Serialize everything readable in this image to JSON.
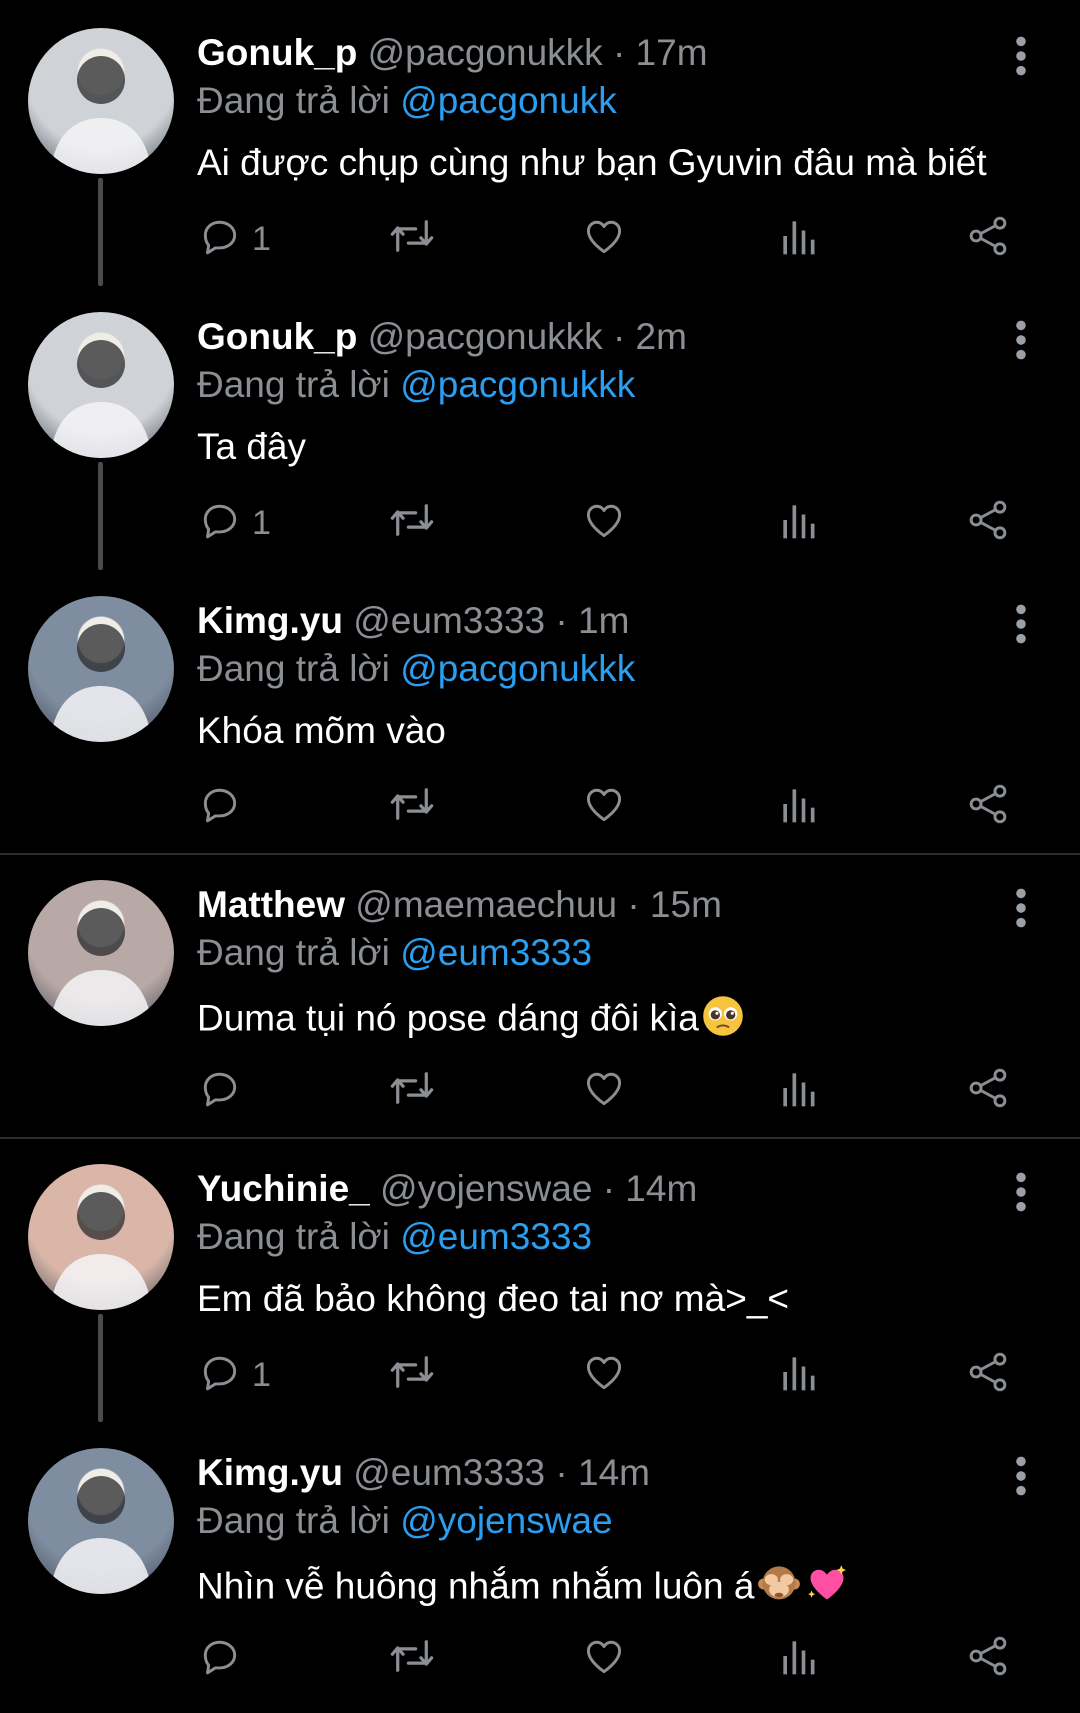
{
  "labels": {
    "replying_to": "Đang trả lời"
  },
  "tweets": [
    {
      "name": "Gonuk_p",
      "handle": "@pacgonukkk",
      "sep": "·",
      "time": "17m",
      "reply_to": "@pacgonukk",
      "text": "Ai được chụp cùng như bạn Gyuvin đâu mà biết",
      "reply_count": "1",
      "emoji": [],
      "avatar_color": "#cfd2d6"
    },
    {
      "name": "Gonuk_p",
      "handle": "@pacgonukkk",
      "sep": "·",
      "time": "2m",
      "reply_to": "@pacgonukkk",
      "text": "Ta đây",
      "reply_count": "1",
      "emoji": [],
      "avatar_color": "#cfd2d6"
    },
    {
      "name": "Kimg.yu",
      "handle": "@eum3333",
      "sep": "·",
      "time": "1m",
      "reply_to": "@pacgonukkk",
      "text": "Khóa mõm vào",
      "reply_count": "",
      "emoji": [],
      "avatar_color": "#7f8da0"
    },
    {
      "name": "Matthew",
      "handle": "@maemaechuu",
      "sep": "·",
      "time": "15m",
      "reply_to": "@eum3333",
      "text": "Duma tụi nó pose dáng đôi kìa",
      "reply_count": "",
      "emoji": [
        "pleading-face"
      ],
      "avatar_color": "#b9a9a6"
    },
    {
      "name": "Yuchinie_",
      "handle": "@yojenswae",
      "sep": "·",
      "time": "14m",
      "reply_to": "@eum3333",
      "text": "Em đã bảo không đeo tai nơ mà>_<",
      "reply_count": "1",
      "emoji": [],
      "avatar_color": "#d9b6a8"
    },
    {
      "name": "Kimg.yu",
      "handle": "@eum3333",
      "sep": "·",
      "time": "14m",
      "reply_to": "@yojenswae",
      "text": "Nhìn vễ huông nhắm nhắm luôn á",
      "reply_count": "",
      "emoji": [
        "see-no-evil-monkey",
        "sparkling-heart"
      ],
      "avatar_color": "#7f8da0"
    }
  ],
  "colors": {
    "background": "#000000",
    "link": "#2b9ef0",
    "muted": "#8b8f94",
    "line": "#4a4a4a"
  }
}
